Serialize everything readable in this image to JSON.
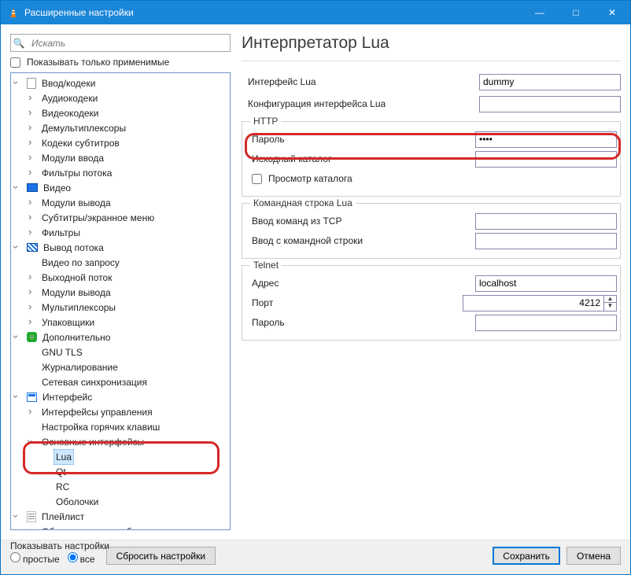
{
  "window": {
    "title": "Расширенные настройки"
  },
  "titlebar_buttons": {
    "minimize": "—",
    "maximize": "□",
    "close": "✕"
  },
  "search": {
    "placeholder": "Искать",
    "applicable_only": "Показывать только применимые"
  },
  "tree": {
    "n0": "Ввод/кодеки",
    "n0_0": "Аудиокодеки",
    "n0_1": "Видеокодеки",
    "n0_2": "Демультиплексоры",
    "n0_3": "Кодеки субтитров",
    "n0_4": "Модули ввода",
    "n0_5": "Фильтры потока",
    "n1": "Видео",
    "n1_0": "Модули вывода",
    "n1_1": "Субтитры/экранное меню",
    "n1_2": "Фильтры",
    "n2": "Вывод потока",
    "n2_0": "Видео по запросу",
    "n2_1": "Выходной поток",
    "n2_2": "Модули вывода",
    "n2_3": "Мультиплексоры",
    "n2_4": "Упаковщики",
    "n3": "Дополнительно",
    "n3_0": "GNU TLS",
    "n3_1": "Журналирование",
    "n3_2": "Сетевая синхронизация",
    "n4": "Интерфейс",
    "n4_0": "Интерфейсы управления",
    "n4_1": "Настройка горячих клавиш",
    "n4_2": "Основные интерфейсы",
    "n4_2_0": "Lua",
    "n4_2_1": "Qt",
    "n4_2_2": "RC",
    "n4_2_3": "Оболочки",
    "n5": "Плейлист",
    "n5_0": "Обнаружение служб"
  },
  "page": {
    "title": "Интерпретатор Lua",
    "iface_label": "Интерфейс Lua",
    "iface_value": "dummy",
    "config_label": "Конфигурация интерфейса Lua",
    "config_value": "",
    "http": {
      "legend": "HTTP",
      "password_label": "Пароль",
      "password_value": "••••",
      "dir_label": "Исходный каталог",
      "dir_value": "",
      "browse_label": "Просмотр каталога"
    },
    "cli": {
      "legend": "Командная строка Lua",
      "tcp_label": "Ввод команд из TCP",
      "tcp_value": "",
      "cmdline_label": "Ввод с командной строки",
      "cmdline_value": ""
    },
    "telnet": {
      "legend": "Telnet",
      "host_label": "Адрес",
      "host_value": "localhost",
      "port_label": "Порт",
      "port_value": "4212",
      "password_label": "Пароль",
      "password_value": ""
    }
  },
  "footer": {
    "section": "Показывать настройки",
    "simple": "простые",
    "all": "все",
    "reset": "Сбросить настройки",
    "save": "Сохранить",
    "cancel": "Отмена"
  }
}
